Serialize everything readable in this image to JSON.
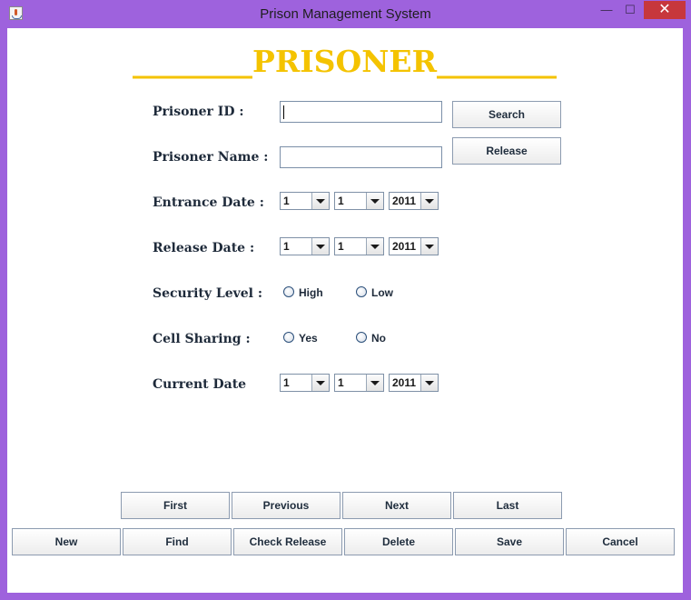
{
  "window": {
    "title": "Prison Management System",
    "min_icon": "minimize-icon",
    "max_icon": "maximize-icon",
    "close_icon": "close-icon",
    "min_glyph": "—",
    "max_glyph": "☐",
    "close_glyph": "✕"
  },
  "header": {
    "title": "________PRISONER________"
  },
  "form": {
    "prisoner_id_label": "Prisoner ID :",
    "prisoner_id_value": "",
    "prisoner_name_label": "Prisoner Name :",
    "prisoner_name_value": "",
    "entrance_date_label": "Entrance Date :",
    "entrance_date": {
      "day": "1",
      "month": "1",
      "year": "2011"
    },
    "release_date_label": "Release Date :",
    "release_date": {
      "day": "1",
      "month": "1",
      "year": "2011"
    },
    "security_level_label": "Security Level :",
    "security_options": [
      "High",
      "Low"
    ],
    "cell_sharing_label": "Cell Sharing :",
    "cell_sharing_options": [
      "Yes",
      "No"
    ],
    "current_date_label": "Current Date",
    "current_date": {
      "day": "1",
      "month": "1",
      "year": "2011"
    }
  },
  "side_buttons": {
    "search": "Search",
    "release": "Release"
  },
  "nav_buttons": [
    "First",
    "Previous",
    "Next",
    "Last"
  ],
  "action_buttons": [
    "New",
    "Find",
    "Check Release",
    "Delete",
    "Save",
    "Cancel"
  ]
}
